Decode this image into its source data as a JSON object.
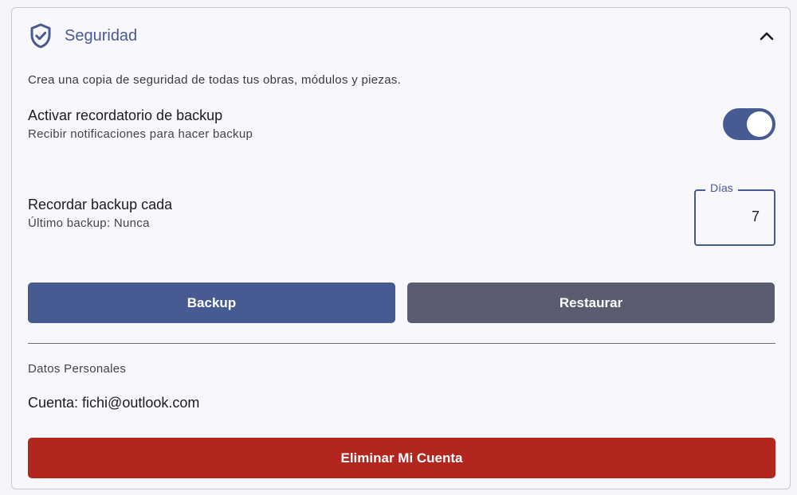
{
  "section": {
    "title": "Seguridad",
    "icon": "shield-check-icon",
    "collapse_icon": "chevron-up-icon",
    "description": "Crea una copia de seguridad de todas tus obras, módulos y piezas."
  },
  "reminder": {
    "title": "Activar recordatorio de backup",
    "subtitle": "Recibir notificaciones para hacer backup",
    "enabled": true
  },
  "frequency": {
    "title": "Recordar backup cada",
    "subtitle": "Último backup: Nunca",
    "field_label": "Días",
    "field_value": "7"
  },
  "actions": {
    "backup_label": "Backup",
    "restore_label": "Restaurar"
  },
  "personal": {
    "section_label": "Datos Personales",
    "account_text": "Cuenta: fichi@outlook.com",
    "delete_label": "Eliminar Mi Cuenta"
  },
  "colors": {
    "primary": "#485a92",
    "secondary": "#5a5d70",
    "danger": "#b3261e"
  }
}
